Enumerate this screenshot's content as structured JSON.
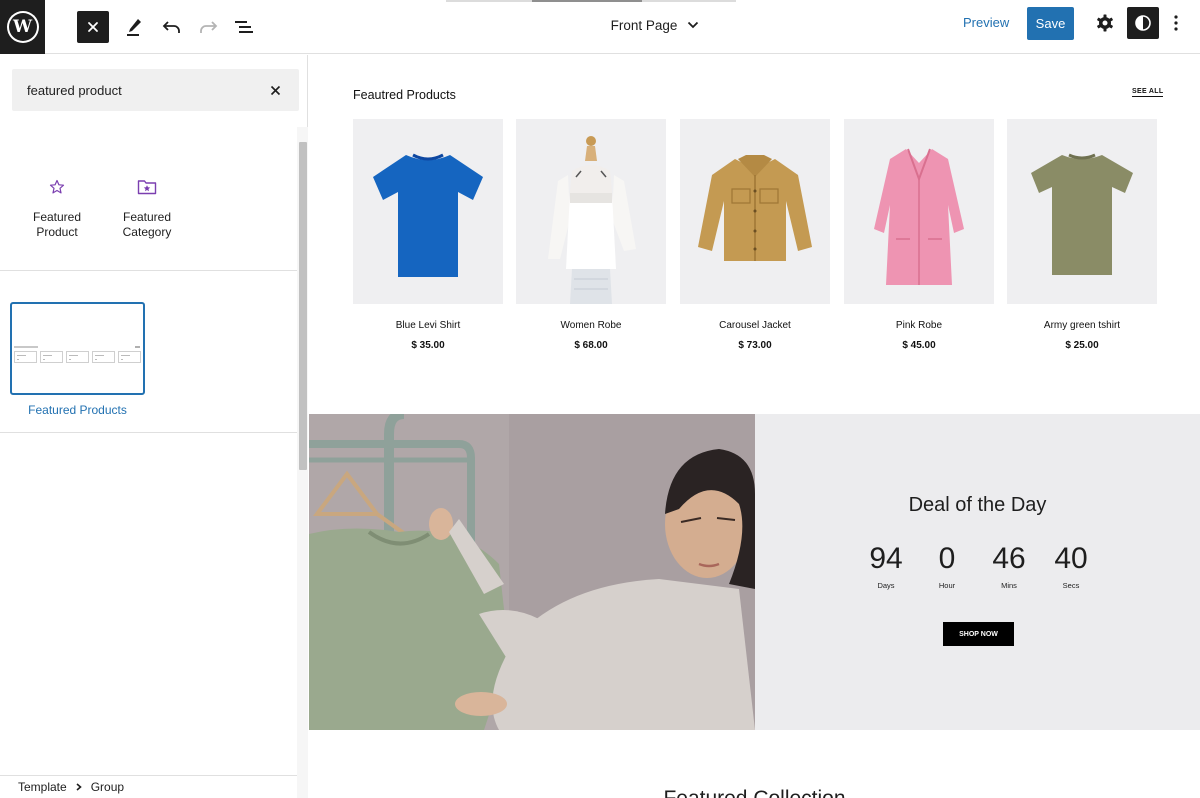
{
  "toolbar": {
    "document_title": "Front Page",
    "preview_label": "Preview",
    "save_label": "Save"
  },
  "inserter": {
    "search": {
      "value": "featured product",
      "placeholder": "Search"
    },
    "blocks": [
      {
        "label": "Featured Product",
        "icon": "star-icon"
      },
      {
        "label": "Featured Category",
        "icon": "folder-star-icon"
      }
    ],
    "patterns": [
      {
        "label": "Featured Products"
      }
    ]
  },
  "breadcrumb": [
    "Template",
    "Group"
  ],
  "canvas": {
    "featured_heading": "Feautred Products",
    "see_all": "SEE ALL",
    "products": [
      {
        "name": "Blue Levi Shirt",
        "price": "$ 35.00",
        "color": "#1565c0"
      },
      {
        "name": "Women Robe",
        "price": "$ 68.00",
        "color": "#f7f5f2"
      },
      {
        "name": "Carousel Jacket",
        "price": "$ 73.00",
        "color": "#c49a52"
      },
      {
        "name": "Pink Robe",
        "price": "$ 45.00",
        "color": "#ee94b2"
      },
      {
        "name": "Army green tshirt",
        "price": "$ 25.00",
        "color": "#8a8c66"
      }
    ],
    "deal": {
      "title": "Deal of the Day",
      "countdown": [
        {
          "value": "94",
          "unit": "Days"
        },
        {
          "value": "0",
          "unit": "Hour"
        },
        {
          "value": "46",
          "unit": "Mins"
        },
        {
          "value": "40",
          "unit": "Secs"
        }
      ],
      "button": "SHOP NOW"
    },
    "next_section_heading": "Featured Collection"
  },
  "colors": {
    "accent": "#2271b1",
    "dark": "#1e1e1e",
    "card_bg": "#efeff1"
  }
}
